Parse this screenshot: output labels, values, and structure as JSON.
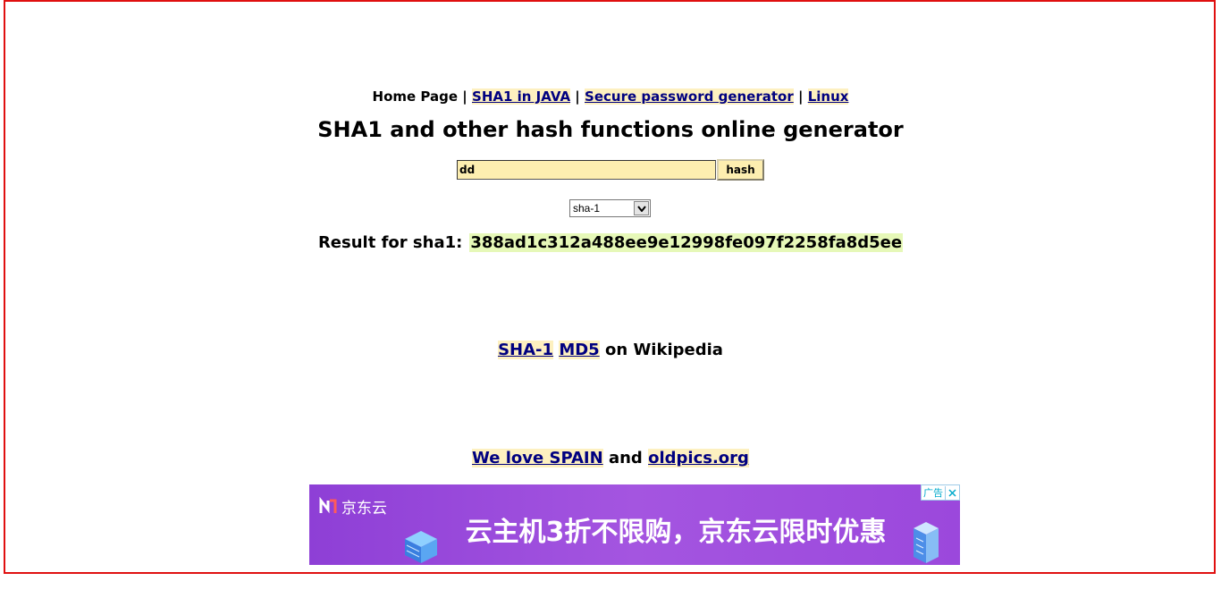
{
  "nav": {
    "home": "Home Page",
    "separator": "|",
    "sha1_java": "SHA1 in JAVA",
    "password_generator": "Secure password generator",
    "linux": "Linux"
  },
  "title": "SHA1 and other hash functions online generator",
  "form": {
    "input_value": "dd",
    "button_label": "hash",
    "algorithm_selected": "sha-1"
  },
  "result": {
    "label": "Result for sha1:",
    "value": "388ad1c312a488ee9e12998fe097f2258fa8d5ee"
  },
  "wiki": {
    "sha1_link": "SHA-1",
    "md5_link": "MD5",
    "suffix": "on Wikipedia"
  },
  "friends": {
    "spain_link": "We love SPAIN",
    "and": "and",
    "oldpics_link": "oldpics.org"
  },
  "ad": {
    "brand": "京东云",
    "headline": "云主机3折不限购，京东云限时优惠",
    "badge": "广告",
    "background": "#a050e0",
    "icons": [
      "server-icon",
      "building-icon",
      "close-icon"
    ]
  },
  "colors": {
    "frame_border": "#e01010",
    "link_text": "#000080",
    "link_highlight": "#fdf0c0",
    "input_background": "#fdeeb0",
    "result_highlight": "#e6f8b8"
  }
}
